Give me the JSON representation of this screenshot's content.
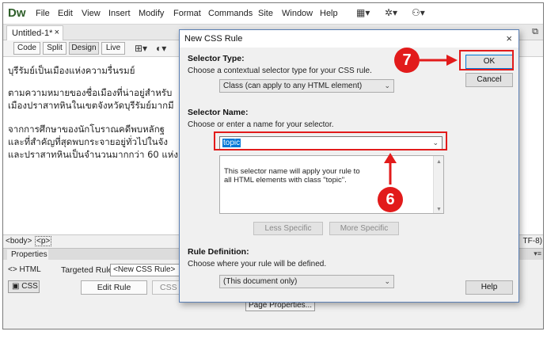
{
  "app": {
    "logo": "Dw",
    "menu": [
      "File",
      "Edit",
      "View",
      "Insert",
      "Modify",
      "Format",
      "Commands",
      "Site",
      "Window",
      "Help"
    ],
    "toolbar_icons": [
      "layout-icon",
      "gear-icon",
      "sync-icon"
    ]
  },
  "document": {
    "tab_label": "Untitled-1*",
    "tab_close": "×",
    "view_buttons": [
      "Code",
      "Split",
      "Design",
      "Live"
    ],
    "paragraphs": [
      "บุรีรัมย์เป็นเมืองแห่งความรื่นรมย์",
      "ตามความหมายของชื่อเมืองที่น่าอยู่สำหรับ",
      "เมืองปราสาทหินในเขตจังหวัดบุรีรัมย์มากมี",
      "จากการศึกษาของนักโบราณคดีพบหลักฐ",
      "และที่สำคัญที่สุดพบกระจายอยู่ทั่วไปในจัง",
      "และปราสาทหินเป็นจำนวนมากกว่า 60 แห่ง"
    ]
  },
  "status_bar": {
    "body_tag": "<body>",
    "p_tag": "<p>",
    "encoding": "TF-8)"
  },
  "properties": {
    "title": "Properties",
    "html_label": "HTML",
    "css_label": "CSS",
    "targeted_rule_label": "Targeted Rule",
    "targeted_rule_value": "<New CSS Rule>",
    "edit_rule": "Edit Rule",
    "css_panel": "CSS Pa",
    "page_properties": "Page Properties..."
  },
  "dialog": {
    "title": "New CSS Rule",
    "close": "×",
    "selector_type_label": "Selector Type:",
    "selector_type_desc": "Choose a contextual selector type for your CSS rule.",
    "selector_type_value": "Class (can apply to any HTML element)",
    "selector_name_label": "Selector Name:",
    "selector_name_desc": "Choose or enter a name for your selector.",
    "selector_name_value": "topic",
    "selector_name_info": "This selector name will apply your rule to\nall HTML elements with class \"topic\".",
    "less_specific": "Less Specific",
    "more_specific": "More Specific",
    "rule_def_label": "Rule Definition:",
    "rule_def_desc": "Choose where your rule will be defined.",
    "rule_def_value": "(This document only)",
    "ok": "OK",
    "cancel": "Cancel",
    "help": "Help"
  },
  "annotations": {
    "step_6": "6",
    "step_7": "7",
    "color": "#e21b1b"
  }
}
